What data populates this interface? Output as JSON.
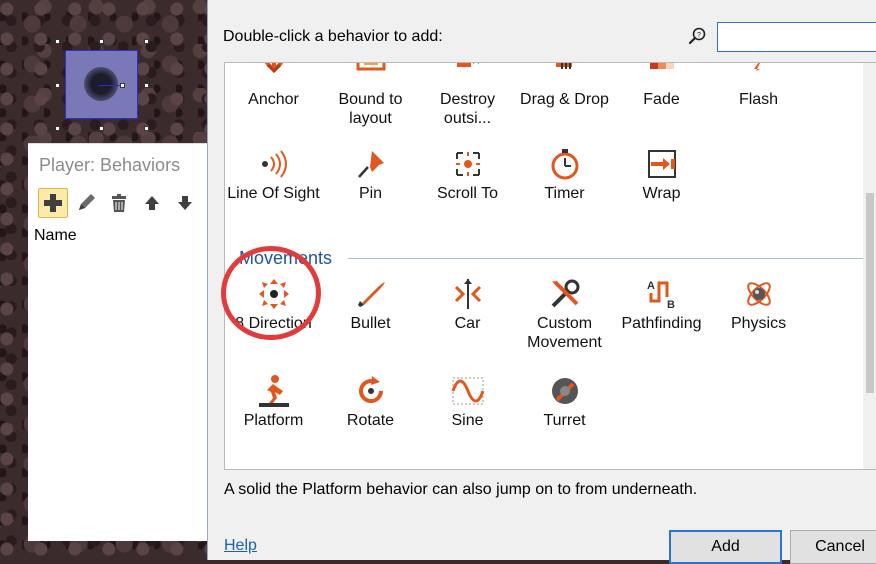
{
  "panel": {
    "title": "Player: Behaviors",
    "column_header": "Name",
    "toolbar": [
      "add-icon",
      "edit-icon",
      "delete-icon",
      "move-up-icon",
      "move-down-icon"
    ]
  },
  "dialog": {
    "instruction": "Double-click a behavior to add:",
    "search_placeholder": "",
    "search_value": "",
    "general_items": [
      {
        "label": "Anchor",
        "icon": "anchor-icon"
      },
      {
        "label": "Bound to layout",
        "icon": "bound-to-layout-icon"
      },
      {
        "label": "Destroy outsi...",
        "icon": "destroy-outside-icon"
      },
      {
        "label": "Drag & Drop",
        "icon": "drag-drop-icon"
      },
      {
        "label": "Fade",
        "icon": "fade-icon"
      },
      {
        "label": "Flash",
        "icon": "flash-icon"
      },
      {
        "label": "Line Of Sight",
        "icon": "line-of-sight-icon"
      },
      {
        "label": "Pin",
        "icon": "pin-icon"
      },
      {
        "label": "Scroll To",
        "icon": "scroll-to-icon"
      },
      {
        "label": "Timer",
        "icon": "timer-icon"
      },
      {
        "label": "Wrap",
        "icon": "wrap-icon"
      }
    ],
    "movements_header": "Movements",
    "movement_items": [
      {
        "label": "8 Direction",
        "icon": "eight-direction-icon"
      },
      {
        "label": "Bullet",
        "icon": "bullet-icon"
      },
      {
        "label": "Car",
        "icon": "car-icon"
      },
      {
        "label": "Custom Movement",
        "icon": "custom-movement-icon"
      },
      {
        "label": "Pathfinding",
        "icon": "pathfinding-icon"
      },
      {
        "label": "Physics",
        "icon": "physics-icon"
      },
      {
        "label": "Platform",
        "icon": "platform-icon"
      },
      {
        "label": "Rotate",
        "icon": "rotate-icon"
      },
      {
        "label": "Sine",
        "icon": "sine-icon"
      },
      {
        "label": "Turret",
        "icon": "turret-icon"
      }
    ],
    "description": "A solid the Platform behavior can also jump on to from underneath.",
    "help_label": "Help",
    "add_label": "Add",
    "cancel_label": "Cancel"
  },
  "colors": {
    "accent": "#2a74d2",
    "section_header": "#1f55a6",
    "highlight": "#e33b3b",
    "icon_orange": "#e2571d"
  }
}
